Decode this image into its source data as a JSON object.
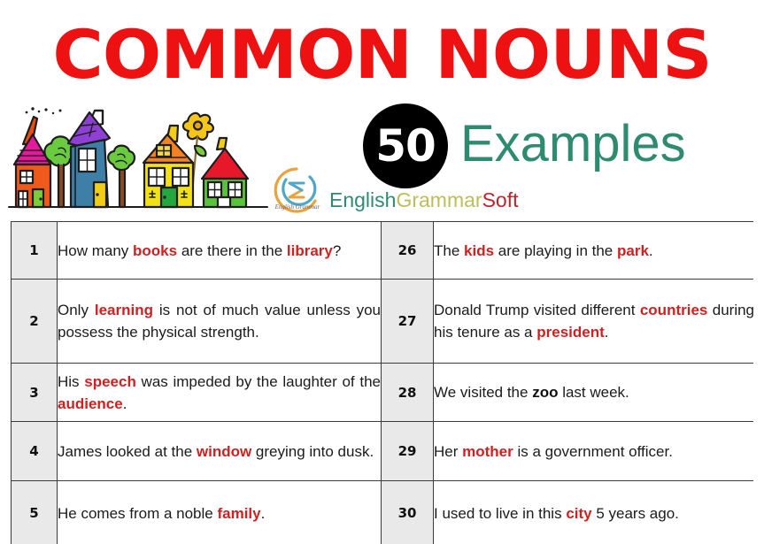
{
  "header": {
    "title": "COMMON NOUNS",
    "badge_count": "50",
    "badge_label": "Examples",
    "brand": {
      "part1": "English",
      "part2": "Grammar",
      "part3": "Soft",
      "logo_caption": "English Grammar"
    },
    "colors": {
      "title_red": "#EE1111",
      "examples_teal": "#2E8B6F",
      "badge_black": "#000000",
      "brand_english": "#2E8B6F",
      "brand_grammar": "#BDBD5A",
      "brand_soft": "#C2222A",
      "highlight_red": "#D02020",
      "number_cell_gray": "#E9E9E9"
    }
  },
  "table": {
    "rows": [
      {
        "left_num": "1",
        "left_parts": [
          {
            "t": "How many ",
            "s": "plain"
          },
          {
            "t": "books",
            "s": "hl"
          },
          {
            "t": " are there in the ",
            "s": "plain"
          },
          {
            "t": "library",
            "s": "hl"
          },
          {
            "t": "?",
            "s": "plain"
          }
        ],
        "right_num": "26",
        "right_parts": [
          {
            "t": "The ",
            "s": "plain"
          },
          {
            "t": "kids",
            "s": "hl"
          },
          {
            "t": " are playing in the ",
            "s": "plain"
          },
          {
            "t": "park",
            "s": "hl"
          },
          {
            "t": ".",
            "s": "plain"
          }
        ],
        "right_justify": false
      },
      {
        "left_num": "2",
        "left_parts": [
          {
            "t": "Only ",
            "s": "plain"
          },
          {
            "t": "learning",
            "s": "hl"
          },
          {
            "t": " is not of much value unless you possess the physical strength.",
            "s": "plain"
          }
        ],
        "right_num": "27",
        "right_parts": [
          {
            "t": "Donald Trump visited different ",
            "s": "plain"
          },
          {
            "t": "countries",
            "s": "hl"
          },
          {
            "t": " during his tenure as a ",
            "s": "plain"
          },
          {
            "t": "president",
            "s": "hl"
          },
          {
            "t": ".",
            "s": "plain"
          }
        ],
        "right_justify": true
      },
      {
        "left_num": "3",
        "left_parts": [
          {
            "t": "His ",
            "s": "plain"
          },
          {
            "t": "speech",
            "s": "hl"
          },
          {
            "t": " was impeded by the laughter of the ",
            "s": "plain"
          },
          {
            "t": "audience",
            "s": "hl"
          },
          {
            "t": ".",
            "s": "plain"
          }
        ],
        "right_num": "28",
        "right_parts": [
          {
            "t": "We visited the ",
            "s": "plain"
          },
          {
            "t": "zoo",
            "s": "hl-black"
          },
          {
            "t": " last week.",
            "s": "plain"
          }
        ],
        "right_justify": false
      },
      {
        "left_num": "4",
        "left_parts": [
          {
            "t": "James looked at the ",
            "s": "plain"
          },
          {
            "t": "window",
            "s": "hl"
          },
          {
            "t": " greying into dusk.",
            "s": "plain"
          }
        ],
        "right_num": "29",
        "right_parts": [
          {
            "t": "Her ",
            "s": "plain"
          },
          {
            "t": "mother",
            "s": "hl"
          },
          {
            "t": " is a government officer.",
            "s": "plain"
          }
        ],
        "right_justify": true
      },
      {
        "left_num": "5",
        "left_parts": [
          {
            "t": "He comes from a noble ",
            "s": "plain"
          },
          {
            "t": "family",
            "s": "hl"
          },
          {
            "t": ".",
            "s": "plain"
          }
        ],
        "right_num": "30",
        "right_parts": [
          {
            "t": "I used to live in this ",
            "s": "plain"
          },
          {
            "t": "city",
            "s": "hl"
          },
          {
            "t": " 5 years ago.",
            "s": "plain"
          }
        ],
        "right_justify": true
      }
    ]
  }
}
